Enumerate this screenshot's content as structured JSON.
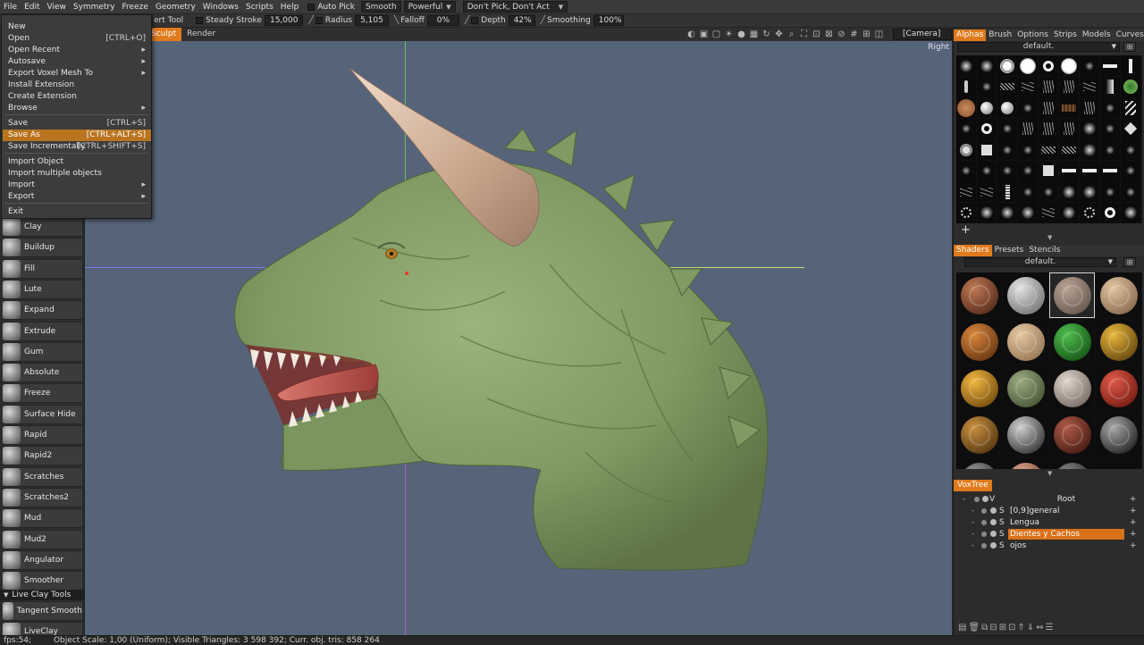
{
  "menubar": {
    "items": [
      "File",
      "Edit",
      "View",
      "Symmetry",
      "Freeze",
      "Geometry",
      "Windows",
      "Scripts",
      "Help"
    ],
    "auto_pick": "Auto Pick",
    "smooth": "Smooth",
    "powerful": "Powerful",
    "dont_pick": "Don't Pick, Don't Act"
  },
  "toolbar": {
    "insert_tool": "ert Tool",
    "steady_stroke_label": "Steady Stroke",
    "steady_stroke_value": "15,000",
    "radius_label": "Radius",
    "radius_value": "5,105",
    "falloff_label": "Falloff",
    "falloff_value": "0%",
    "depth_label": "Depth",
    "depth_value": "42%",
    "smoothing_label": "Smoothing",
    "smoothing_value": "100%"
  },
  "rooms": {
    "sculpt": "Sculpt",
    "render": "Render",
    "camera": "[Camera]"
  },
  "viewport": {
    "view_label": "Right"
  },
  "file_menu": {
    "items": [
      {
        "label": "New",
        "shortcut": ""
      },
      {
        "label": "Open",
        "shortcut": "[CTRL+O]"
      },
      {
        "label": "Open Recent",
        "shortcut": "▸"
      },
      {
        "label": "Autosave",
        "shortcut": "▸"
      },
      {
        "label": "Export Voxel Mesh To",
        "shortcut": "▸"
      },
      {
        "label": "Install Extension",
        "shortcut": ""
      },
      {
        "label": "Create Extension",
        "shortcut": ""
      },
      {
        "label": "Browse",
        "shortcut": "▸"
      },
      {
        "label": "Save",
        "shortcut": "[CTRL+S]"
      },
      {
        "label": "Save As",
        "shortcut": "[CTRL+ALT+S]"
      },
      {
        "label": "Save Incrementally",
        "shortcut": "[CTRL+SHIFT+S]"
      },
      {
        "label": "Import Object",
        "shortcut": ""
      },
      {
        "label": "Import multiple objects",
        "shortcut": ""
      },
      {
        "label": "Import",
        "shortcut": "▸"
      },
      {
        "label": "Export",
        "shortcut": "▸"
      },
      {
        "label": "Exit",
        "shortcut": ""
      }
    ]
  },
  "tools": [
    "Clay",
    "Buildup",
    "Fill",
    "Lute",
    "Expand",
    "Extrude",
    "Gum",
    "Absolute",
    "Freeze",
    "Surface Hide",
    "Rapid",
    "Rapid2",
    "Scratches",
    "Scratches2",
    "Mud",
    "Mud2",
    "Angulator",
    "Smoother"
  ],
  "live_clay": {
    "header": "Live Clay Tools",
    "tools": [
      "Tangent Smooth",
      "LiveClay"
    ]
  },
  "right_panel": {
    "tabs": [
      "Alphas",
      "Brush",
      "Options",
      "Strips",
      "Models",
      "Curves"
    ],
    "alpha_preset": "default.",
    "shader_tabs": [
      "Shaders",
      "Presets",
      "Stencils"
    ],
    "shader_preset": "default.",
    "voxtree_tab": "VoxTree",
    "voxtree": [
      {
        "type": "V",
        "name": "Root"
      },
      {
        "type": "S",
        "name": "[0,9]general"
      },
      {
        "type": "S",
        "name": "Lengua"
      },
      {
        "type": "S",
        "name": "Dientes y Cachos"
      },
      {
        "type": "S",
        "name": "ojos"
      }
    ]
  },
  "status": {
    "fps": "fps:54;",
    "info": "Object Scale: 1,00 (Uniform); Visible Triangles: 3 598 392; Curr. obj. tris: 858 264"
  },
  "colors": {
    "accent": "#e07a1c",
    "viewport_bg": "#56647a",
    "skin": "#7f9a62",
    "horn": "#cba88e",
    "tongue": "#b44b45"
  }
}
